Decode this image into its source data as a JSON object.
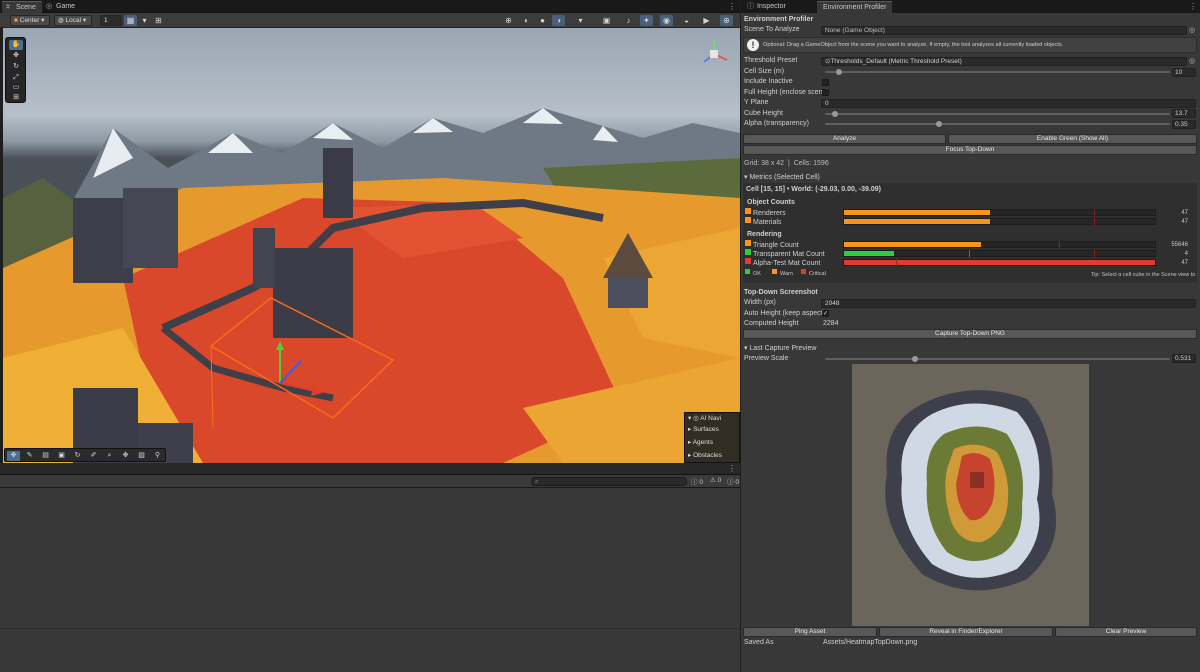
{
  "tabs_left": {
    "scene": "Scene",
    "game": "Game"
  },
  "scene_toolbar": {
    "pivot": "Center",
    "space": "Local",
    "snap_value": "1"
  },
  "viewport": {
    "ai_navigation": {
      "title": "AI Navi",
      "items": [
        "Surfaces",
        "Agents",
        "Obstacles"
      ]
    }
  },
  "console": {
    "counts": [
      "0",
      "0",
      "0"
    ],
    "search_placeholder": ""
  },
  "tabs_right": {
    "inspector": "Inspector",
    "profiler": "Environment Profiler"
  },
  "profiler": {
    "header": "Environment Profiler",
    "scene_to_analyze_label": "Scene To Analyze",
    "scene_to_analyze_value": "None (Game Object)",
    "help_text": "Optional: Drag a GameObject from the scene you want to analyze. If empty, the tool analyzes all currently loaded objects.",
    "threshold_label": "Threshold Preset",
    "threshold_value": "Thresholds_Default (Metric Threshold Preset)",
    "cell_size_label": "Cell Size (m)",
    "cell_size_value": "10",
    "cell_size_fraction": 0.04,
    "include_inactive_label": "Include Inactive",
    "full_height_label": "Full Height (enclose scene)",
    "y_plane_label": "Y Plane",
    "y_plane_value": "0",
    "cube_height_label": "Cube Height",
    "cube_height_value": "13.7",
    "cube_height_fraction": 0.03,
    "alpha_label": "Alpha (transparency)",
    "alpha_value": "0.35",
    "alpha_fraction": 0.33,
    "analyze_button": "Analyze",
    "enable_green_button": "Enable Green (Show All)",
    "focus_button": "Focus Top-Down",
    "grid_info": "Grid: 38 x 42",
    "cells_info": "Cells: 1596",
    "metrics_foldout": "Metrics (Selected Cell)",
    "cell_info": "Cell [15, 15]  •  World: (-29.03, 0.00, -39.09)",
    "object_counts_heading": "Object Counts",
    "rendering_heading": "Rendering",
    "metrics": [
      {
        "name": "Renderers",
        "value": "47",
        "fill": 0.47,
        "color": "#f7941d"
      },
      {
        "name": "Materials",
        "value": "47",
        "fill": 0.47,
        "color": "#f7941d"
      },
      {
        "name": "Triangle Count",
        "value": "55646",
        "fill": 0.44,
        "color": "#f7941d"
      },
      {
        "name": "Transparent Mat Count",
        "value": "4",
        "fill": 0.16,
        "color": "#2ecc40"
      },
      {
        "name": "Alpha-Test Mat Count",
        "value": "47",
        "fill": 1.0,
        "color": "#e23b2f"
      }
    ],
    "legend": {
      "ok": "OK",
      "warn": "Warn",
      "critical": "Critical"
    },
    "tip": "Tip: Select a cell cube in the Scene view to",
    "screenshot_heading": "Top-Down Screenshot",
    "width_label": "Width (px)",
    "width_value": "2048",
    "auto_height_label": "Auto Height (keep aspect)",
    "computed_height_label": "Computed Height",
    "computed_height_value": "2284",
    "capture_button": "Capture Top-Down PNG",
    "last_capture_foldout": "Last Capture Preview",
    "preview_scale_label": "Preview Scale",
    "preview_scale_value": "0.531",
    "preview_scale_fraction": 0.26,
    "ping_button": "Ping Asset",
    "reveal_button": "Reveal in Finder/Explorer",
    "clear_button": "Clear Preview",
    "saved_as_label": "Saved As",
    "saved_as_value": "Assets/HeatmapTopDown.png"
  },
  "colors": {
    "ok": "#2ecc40",
    "warn": "#f7941d",
    "critical": "#e23b2f",
    "accent": "#4d6e93"
  }
}
